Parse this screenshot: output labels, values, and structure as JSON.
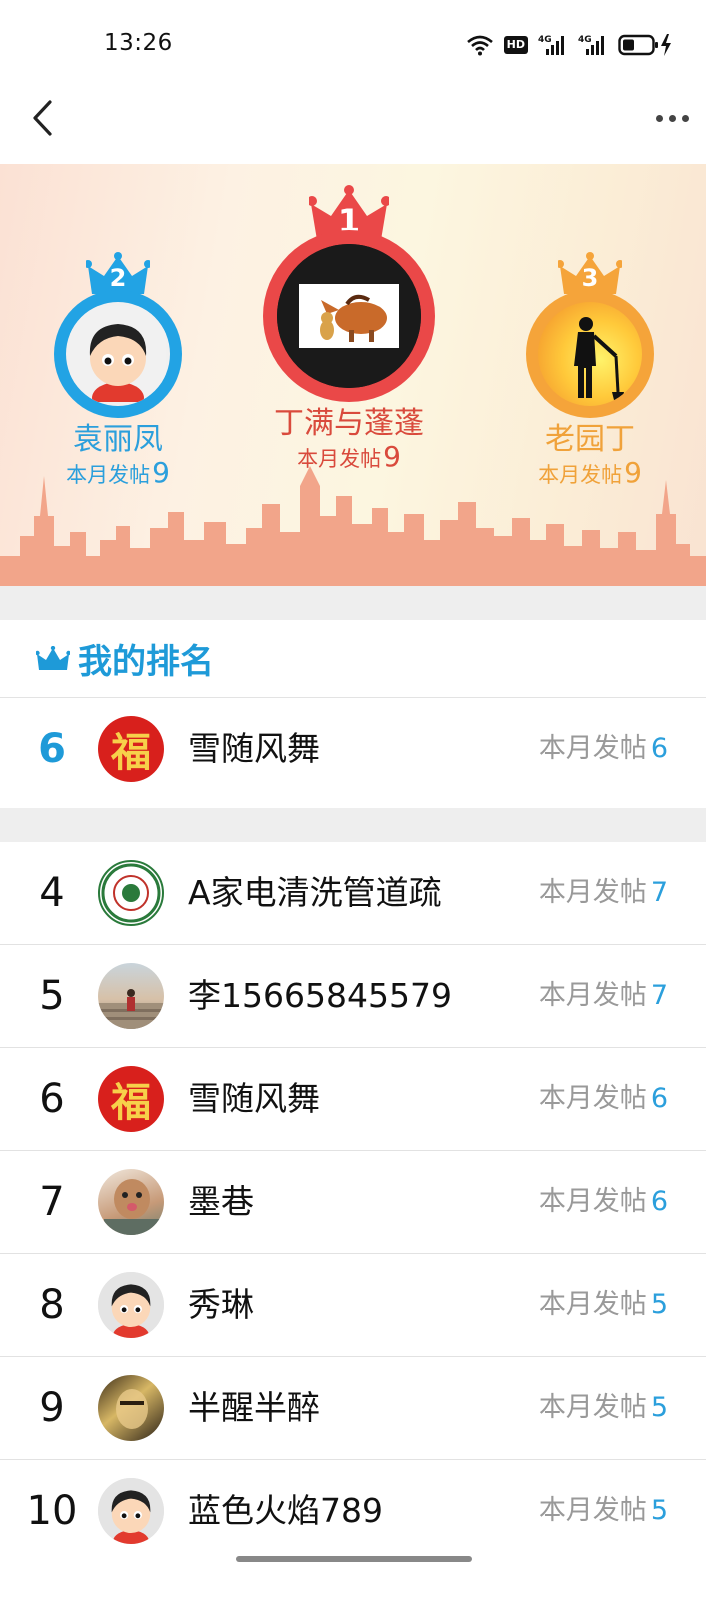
{
  "status_bar": {
    "time": "13:26",
    "hd_label": "HD",
    "net_label_1": "4G",
    "net_label_2": "4G"
  },
  "nav": {
    "back_icon": "chevron-left-icon",
    "more_icon": "more-dots-icon"
  },
  "podium": {
    "first": {
      "rank": "1",
      "name": "丁满与蓬蓬",
      "count_label": "本月发帖",
      "count": "9"
    },
    "second": {
      "rank": "2",
      "name": "袁丽凤",
      "count_label": "本月发帖",
      "count": "9"
    },
    "third": {
      "rank": "3",
      "name": "老园丁",
      "count_label": "本月发帖",
      "count": "9"
    }
  },
  "my_rank": {
    "title": "我的排名",
    "rank": "6",
    "avatar_text": "福",
    "name": "雪随风舞",
    "count_label": "本月发帖",
    "count": "6"
  },
  "list": [
    {
      "rank": "4",
      "name": "A家电清洗管道疏",
      "count_label": "本月发帖",
      "count": "7"
    },
    {
      "rank": "5",
      "name": "李15665845579",
      "count_label": "本月发帖",
      "count": "7"
    },
    {
      "rank": "6",
      "name": "雪随风舞",
      "count_label": "本月发帖",
      "count": "6",
      "avatar_text": "福"
    },
    {
      "rank": "7",
      "name": "墨巷",
      "count_label": "本月发帖",
      "count": "6"
    },
    {
      "rank": "8",
      "name": "秀琳",
      "count_label": "本月发帖",
      "count": "5"
    },
    {
      "rank": "9",
      "name": "半醒半醉",
      "count_label": "本月发帖",
      "count": "5"
    },
    {
      "rank": "10",
      "name": "蓝色火焰789",
      "count_label": "本月发帖",
      "count": "5"
    }
  ],
  "colors": {
    "accent_blue": "#1e9ad8",
    "first_red": "#ea4848",
    "second_blue": "#22a3e4",
    "third_orange": "#f5a43a"
  }
}
